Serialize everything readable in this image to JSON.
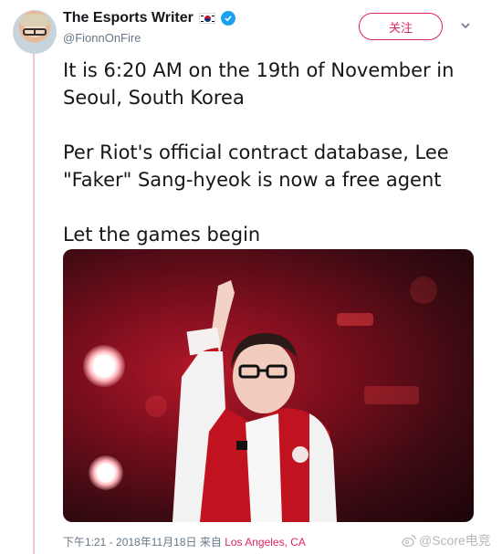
{
  "header": {
    "display_name": "The Esports Writer",
    "handle": "@FionnOnFire",
    "follow_label": "关注",
    "flag_icon": "south-korea-flag-icon",
    "verified_icon": "verified-badge-icon"
  },
  "tweet": {
    "paragraphs": [
      "It is 6:20 AM on the 19th of November in Seoul, South Korea",
      "Per Riot's official contract database, Lee \"Faker\" Sang-hyeok is now a free agent",
      "Let the games begin"
    ]
  },
  "meta": {
    "timestamp": "下午1:21 - 2018年11月18日 来自",
    "location": "Los Angeles, CA"
  },
  "watermark": {
    "text": "@Score电竞"
  },
  "colors": {
    "accent": "#e0245e",
    "verified": "#1da1f2",
    "rule": "#f2c4cf"
  }
}
